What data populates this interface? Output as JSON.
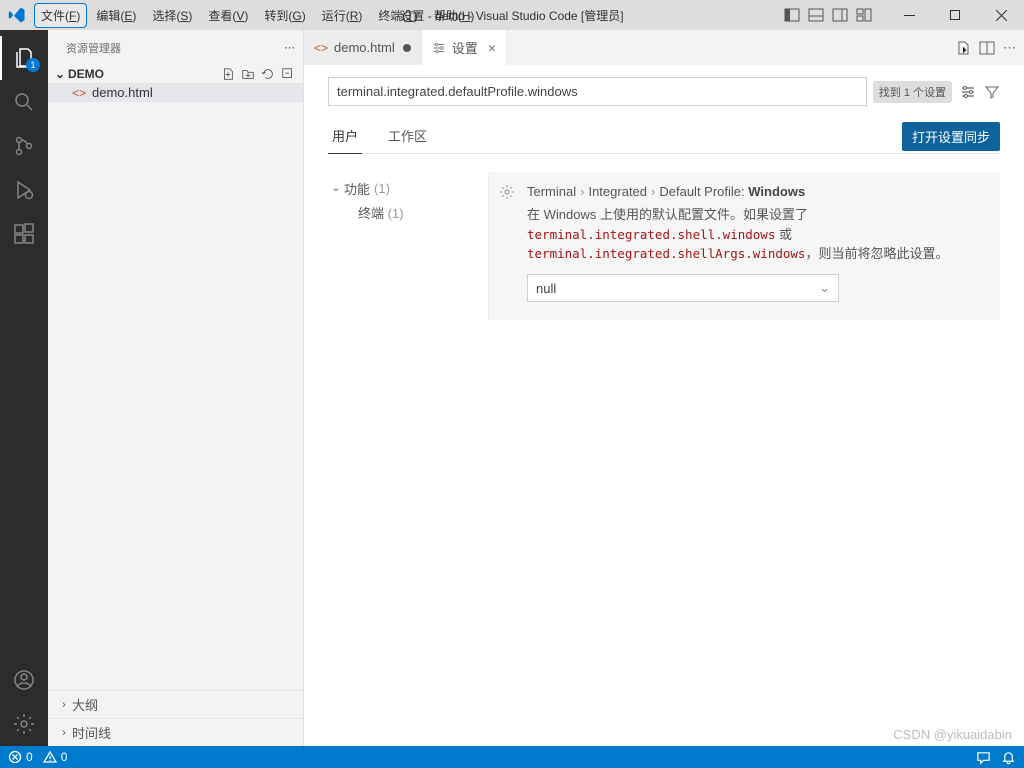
{
  "titlebar": {
    "title": "设置 - demo - Visual Studio Code [管理员]",
    "menu": {
      "file": "文件(",
      "file_k": "F",
      "file_e": ")",
      "edit": "编辑(",
      "edit_k": "E",
      "edit_e": ")",
      "select": "选择(",
      "select_k": "S",
      "select_e": ")",
      "view": "查看(",
      "view_k": "V",
      "view_e": ")",
      "go": "转到(",
      "go_k": "G",
      "go_e": ")",
      "run": "运行(",
      "run_k": "R",
      "run_e": ")",
      "terminal": "终端(",
      "terminal_k": "T",
      "terminal_e": ")",
      "help": "帮助(",
      "help_k": "H",
      "help_e": ")"
    }
  },
  "activitybar": {
    "badge": "1"
  },
  "sidebar": {
    "title": "资源管理器",
    "folder": "DEMO",
    "file1": "demo.html",
    "outline": "大纲",
    "timeline": "时间线"
  },
  "tabs": {
    "t1": "demo.html",
    "t2": "设置"
  },
  "settings": {
    "search_value": "terminal.integrated.defaultProfile.windows",
    "found": "找到 1 个设置",
    "scope_user": "用户",
    "scope_ws": "工作区",
    "sync": "打开设置同步",
    "toc": {
      "features": "功能",
      "features_count": "(1)",
      "terminal": "终端",
      "terminal_count": "(1)"
    },
    "item": {
      "crumb1": "Terminal",
      "crumb2": "Integrated",
      "crumb3": "Default Profile:",
      "crumb4": "Windows",
      "desc_a": "在 Windows 上使用的默认配置文件。如果设置了 ",
      "code1": "terminal.integrated.shell.windows",
      "desc_b": " 或 ",
      "code2": "terminal.integrated.shellArgs.windows",
      "desc_c": "，则当前将忽略此设置。",
      "value": "null"
    }
  },
  "statusbar": {
    "errors": "0",
    "warnings": "0"
  },
  "watermark": "CSDN @yikuaidabin"
}
